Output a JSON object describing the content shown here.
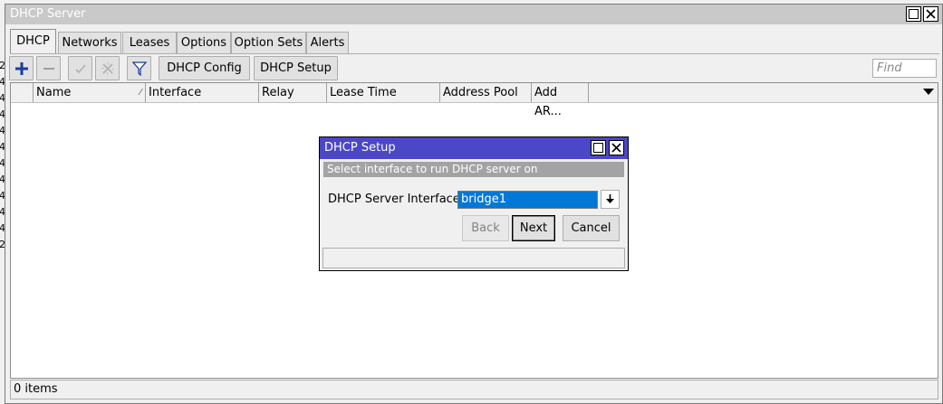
{
  "edge_chars": [
    "2",
    "4",
    "4",
    "4",
    "4",
    "4",
    "4",
    "4",
    "4",
    "4",
    "4",
    "2"
  ],
  "window": {
    "title": "DHCP Server"
  },
  "tabs": [
    "DHCP",
    "Networks",
    "Leases",
    "Options",
    "Option Sets",
    "Alerts"
  ],
  "active_tab": "DHCP",
  "toolbar": {
    "add_icon": "plus-icon",
    "remove_icon": "minus-icon",
    "enable_icon": "check-icon",
    "disable_icon": "cross-icon",
    "filter_icon": "filter-icon",
    "dhcp_config_label": "DHCP Config",
    "dhcp_setup_label": "DHCP Setup",
    "find_placeholder": "Find"
  },
  "table": {
    "columns": [
      "Name",
      "Interface",
      "Relay",
      "Lease Time",
      "Address Pool",
      "Add AR..."
    ],
    "sort_column": "Name",
    "rows": []
  },
  "status": {
    "items_text": "0 items"
  },
  "dialog": {
    "title": "DHCP Setup",
    "banner": "Select interface to run DHCP server on",
    "field_label": "DHCP Server Interface:",
    "field_value": "bridge1",
    "back_label": "Back",
    "next_label": "Next",
    "cancel_label": "Cancel"
  },
  "colors": {
    "dialog_titlebar": "#4c46c8",
    "selection": "#0078d7",
    "window_titlebar": "#c9c9c9",
    "add_icon": "#1a3d9c"
  }
}
